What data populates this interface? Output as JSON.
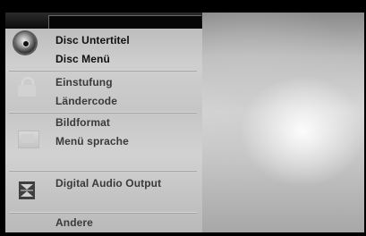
{
  "menu": {
    "items": [
      {
        "label": "Disc Untertitel",
        "group": "disc",
        "selected_group": true
      },
      {
        "label": "Disc Menü",
        "group": "disc",
        "selected_group": true
      },
      {
        "label": "Einstufung",
        "group": "lock",
        "selected_group": false
      },
      {
        "label": "Ländercode",
        "group": "lock",
        "selected_group": false
      },
      {
        "label": "Bildformat",
        "group": "display",
        "selected_group": false
      },
      {
        "label": "Menü sprache",
        "group": "display",
        "selected_group": false
      },
      {
        "label": "Digital Audio Output",
        "group": "audio",
        "selected_group": false
      },
      {
        "label": "Andere",
        "group": "other",
        "selected_group": false
      }
    ]
  },
  "icons": {
    "disc": "disc-icon",
    "lock": "lock-icon",
    "display": "screen-icon",
    "audio": "audio-output-icon"
  },
  "colors": {
    "panel": "#c9c9c9",
    "text": "#111111",
    "title_bar": "#111111"
  }
}
